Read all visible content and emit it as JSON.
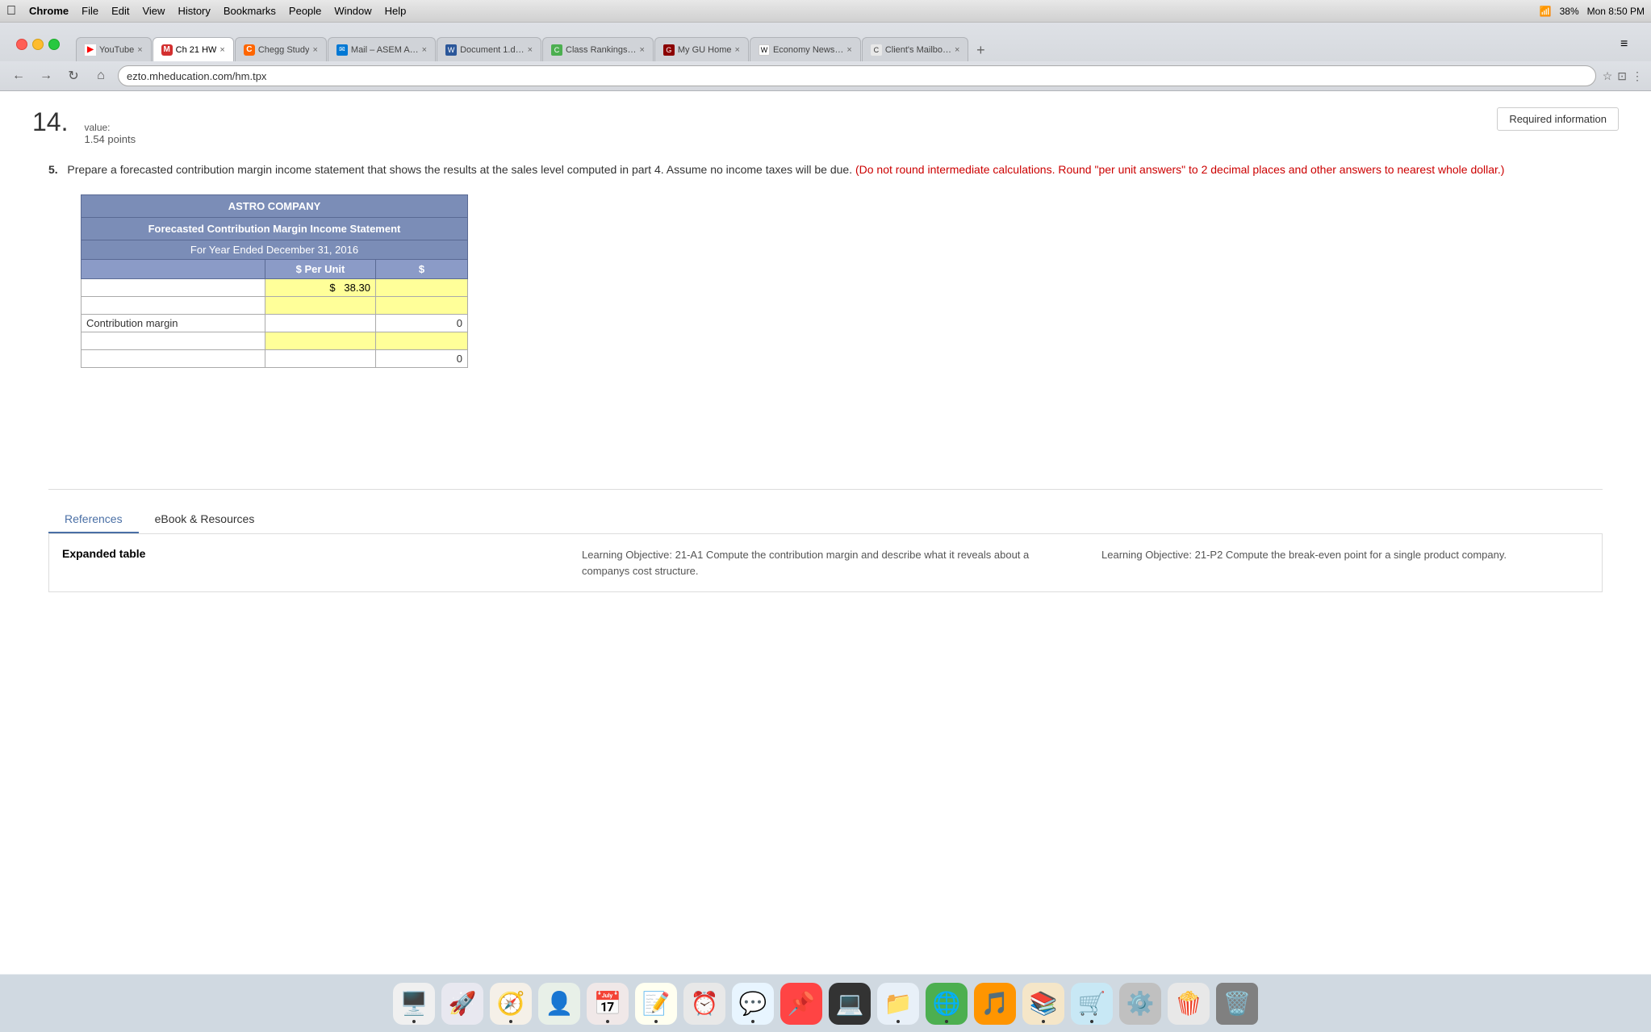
{
  "menubar": {
    "apple": "⌘",
    "items": [
      "Chrome",
      "File",
      "Edit",
      "View",
      "History",
      "Bookmarks",
      "People",
      "Window",
      "Help"
    ],
    "right": {
      "wifi": "WiFi",
      "battery": "38%",
      "time": "Mon 8:50 PM"
    }
  },
  "tabs": [
    {
      "id": "youtube",
      "label": "YouTube",
      "favicon": "YT",
      "favicon_type": "yt",
      "active": false
    },
    {
      "id": "ch21hw",
      "label": "Ch 21 HW",
      "favicon": "M",
      "favicon_type": "m",
      "active": true
    },
    {
      "id": "chegg",
      "label": "Chegg Study",
      "favicon": "C",
      "favicon_type": "ch",
      "active": false
    },
    {
      "id": "mail",
      "label": "Mail – ASEM A…",
      "favicon": "✉",
      "favicon_type": "ms",
      "active": false
    },
    {
      "id": "doc",
      "label": "Document 1.d…",
      "favicon": "W",
      "favicon_type": "wd",
      "active": false
    },
    {
      "id": "class",
      "label": "Class Rankings…",
      "favicon": "C",
      "favicon_type": "cr",
      "active": false
    },
    {
      "id": "mygu",
      "label": "My GU Home",
      "favicon": "G",
      "favicon_type": "mcu",
      "active": false
    },
    {
      "id": "economy",
      "label": "Economy News…",
      "favicon": "W",
      "favicon_type": "wsj",
      "active": false
    },
    {
      "id": "client",
      "label": "Client's Mailbo…",
      "favicon": "C",
      "favicon_type": "cl",
      "active": false
    }
  ],
  "address_bar": {
    "url": "ezto.mheducation.com/hm.tpx"
  },
  "question": {
    "number": "14.",
    "value_label": "value:",
    "points": "1.54 points",
    "required_btn": "Required information",
    "part_number": "5.",
    "instruction_main": "Prepare a forecasted contribution margin income statement that shows the results at the sales level computed in part 4. Assume no income taxes will be due.",
    "instruction_red": "(Do not round intermediate calculations. Round \"per unit answers\" to 2 decimal places and other answers to nearest whole dollar.)"
  },
  "table": {
    "company": "ASTRO COMPANY",
    "title": "Forecasted Contribution Margin Income Statement",
    "period": "For Year Ended December 31, 2016",
    "col_per_unit": "$ Per Unit",
    "col_dollar": "$",
    "rows": [
      {
        "label": "",
        "per_unit": "$ 38.30",
        "dollar": "",
        "input": true,
        "highlight": true
      },
      {
        "label": "",
        "per_unit": "",
        "dollar": "",
        "input": true,
        "highlight": true
      },
      {
        "label": "Contribution margin",
        "per_unit": "",
        "dollar": "0",
        "input": false,
        "highlight": false
      },
      {
        "label": "",
        "per_unit": "",
        "dollar": "",
        "input": true,
        "highlight": true
      },
      {
        "label": "",
        "per_unit": "",
        "dollar": "0",
        "input": false,
        "highlight": false
      }
    ]
  },
  "references": {
    "tab_references": "References",
    "tab_ebook": "eBook & Resources",
    "expanded_table_label": "Expanded table",
    "lo1": "Learning Objective: 21-A1 Compute the contribution margin and describe what it reveals about a companys cost structure.",
    "lo2": "Learning Objective: 21-P2 Compute the break-even point for a single product company."
  }
}
